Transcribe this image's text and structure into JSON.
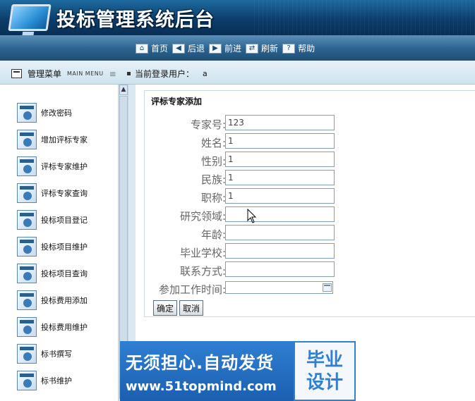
{
  "app": {
    "title": "投标管理系统后台"
  },
  "toolbar": {
    "items": [
      {
        "label": "首页",
        "icon": "⌂"
      },
      {
        "label": "后退",
        "icon": "◀"
      },
      {
        "label": "前进",
        "icon": "▶"
      },
      {
        "label": "刷新",
        "icon": "⇄"
      },
      {
        "label": "帮助",
        "icon": "?"
      }
    ]
  },
  "header": {
    "menu_title": "管理菜单",
    "menu_sub": "MAIN MENU",
    "menu_lines": "≡",
    "user_label": "当前登录用户：",
    "user_name": "a"
  },
  "sidebar": {
    "items": [
      {
        "label": "修改密码"
      },
      {
        "label": "增加评标专家"
      },
      {
        "label": "评标专家维护"
      },
      {
        "label": "评标专家查询"
      },
      {
        "label": "投标项目登记"
      },
      {
        "label": "投标项目维护"
      },
      {
        "label": "投标项目查询"
      },
      {
        "label": "投标费用添加"
      },
      {
        "label": "投标费用维护"
      },
      {
        "label": "标书撰写"
      },
      {
        "label": "标书维护"
      }
    ],
    "scroll_up_icon": "▲"
  },
  "form": {
    "title": "评标专家添加",
    "fields": [
      {
        "label": "专家号:",
        "value": "123"
      },
      {
        "label": "姓名:",
        "value": "1"
      },
      {
        "label": "性别:",
        "value": "1"
      },
      {
        "label": "民族:",
        "value": "1"
      },
      {
        "label": "职称:",
        "value": "1"
      },
      {
        "label": "研究领域:",
        "value": ""
      },
      {
        "label": "年龄:",
        "value": ""
      },
      {
        "label": "毕业学校:",
        "value": ""
      },
      {
        "label": "联系方式:",
        "value": ""
      },
      {
        "label": "参加工作时间:",
        "value": ""
      }
    ],
    "ok_label": "确定",
    "cancel_label": "取消"
  },
  "watermark": {
    "line1": "无须担心.自动发货",
    "line2": "www.51topmind.com",
    "right_top": "毕业",
    "right_bottom": "设计"
  }
}
